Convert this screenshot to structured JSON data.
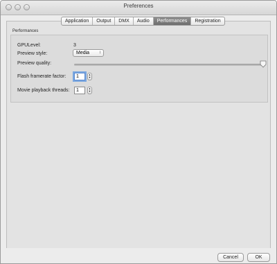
{
  "window": {
    "title": "Preferences"
  },
  "tabs": [
    {
      "label": "Application",
      "active": false
    },
    {
      "label": "Output",
      "active": false
    },
    {
      "label": "DMX",
      "active": false
    },
    {
      "label": "Audio",
      "active": false
    },
    {
      "label": "Performances",
      "active": true
    },
    {
      "label": "Registration",
      "active": false
    }
  ],
  "group": {
    "title": "Performances"
  },
  "settings": {
    "gpu_level_label": "GPULevel:",
    "gpu_level_value": "3",
    "preview_style_label": "Preview style:",
    "preview_style_value": "Media",
    "preview_quality_label": "Preview quality:",
    "preview_quality_level": 1.0,
    "flash_framerate_label": "Flash framerate factor:",
    "flash_framerate_value": "1",
    "movie_threads_label": "Movie playback threads:",
    "movie_threads_value": "1"
  },
  "buttons": {
    "cancel": "Cancel",
    "ok": "OK"
  },
  "icons": {
    "popup_arrows": "updown-chevron-icon",
    "stepper": "stepper-arrows-icon",
    "slider_thumb": "slider-knob-icon"
  }
}
